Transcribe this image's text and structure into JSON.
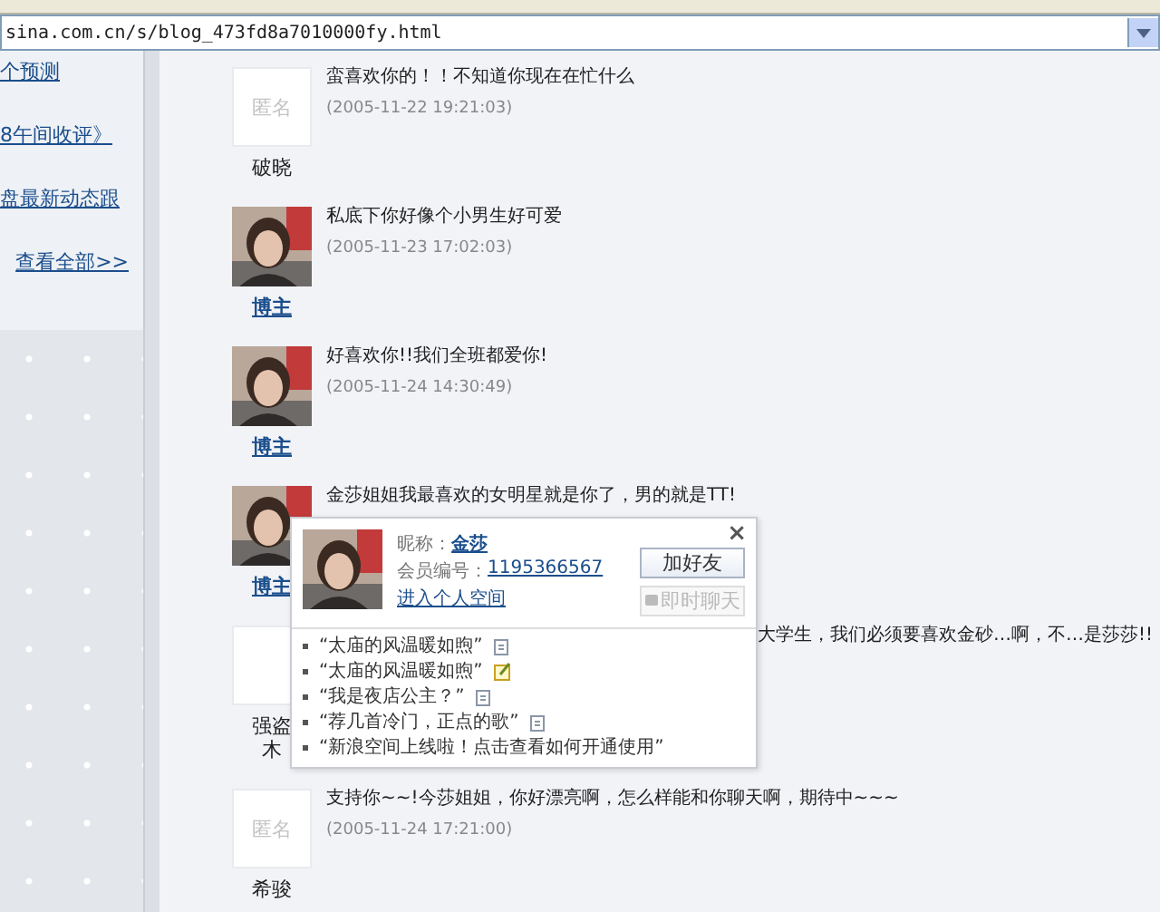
{
  "address_bar": {
    "url": "sina.com.cn/s/blog_473fd8a7010000fy.html"
  },
  "sidebar": {
    "links": [
      "个预测",
      "8午间收评》",
      "盘最新动态跟",
      "查看全部>>"
    ]
  },
  "comments": [
    {
      "kind": "anonymous",
      "avatar_label": "匿名",
      "name": "破晓",
      "name_link": false,
      "text": "蛮喜欢你的！！不知道你现在在忙什么",
      "time": "(2005-11-22 19:21:03)",
      "covered": false
    },
    {
      "name": "博主",
      "name_link": true,
      "text": "私底下你好像个小男生好可爱",
      "time": "(2005-11-23 17:02:03)",
      "covered": false
    },
    {
      "name": "博主",
      "name_link": true,
      "text": "好喜欢你!!我们全班都爱你!",
      "time": "(2005-11-24 14:30:49)",
      "covered": false
    },
    {
      "name": "博主",
      "name_link": true,
      "text": "金莎姐姐我最喜欢的女明星就是你了，男的就是TT!",
      "covered": false
    },
    {
      "kind": "anonymous",
      "name": "强盗木",
      "name_link": false,
      "text": "大学生，我们必须要喜欢金砂…啊，不…是莎莎!!",
      "covered": true
    },
    {
      "kind": "anonymous",
      "avatar_label": "匿名",
      "name": "希骏",
      "name_link": false,
      "text": "支持你~~!今莎姐姐，你好漂亮啊，怎么样能和你聊天啊，期待中~~~",
      "time": "(2005-11-24 17:21:00)",
      "covered": false
    }
  ],
  "popup": {
    "close": "×",
    "nickname_label": "昵称：",
    "nickname": "金莎",
    "member_label": "会员编号：",
    "member_id": "1195366567",
    "space_link": "进入个人空间",
    "buttons": [
      {
        "label": "加好友",
        "disabled": false
      },
      {
        "label": "即时聊天",
        "disabled": true
      }
    ],
    "items": [
      {
        "text": "“太庙的风温暖如煦”",
        "kind": "post"
      },
      {
        "text": "“太庙的风温暖如煦”",
        "kind": "edit"
      },
      {
        "text": "“我是夜店公主？”",
        "kind": "post"
      },
      {
        "text": "“荐几首冷门，正点的歌”",
        "kind": "post"
      },
      {
        "text": "“新浪空间上线啦！点击查看如何开通使用”",
        "kind": "notice"
      }
    ]
  }
}
